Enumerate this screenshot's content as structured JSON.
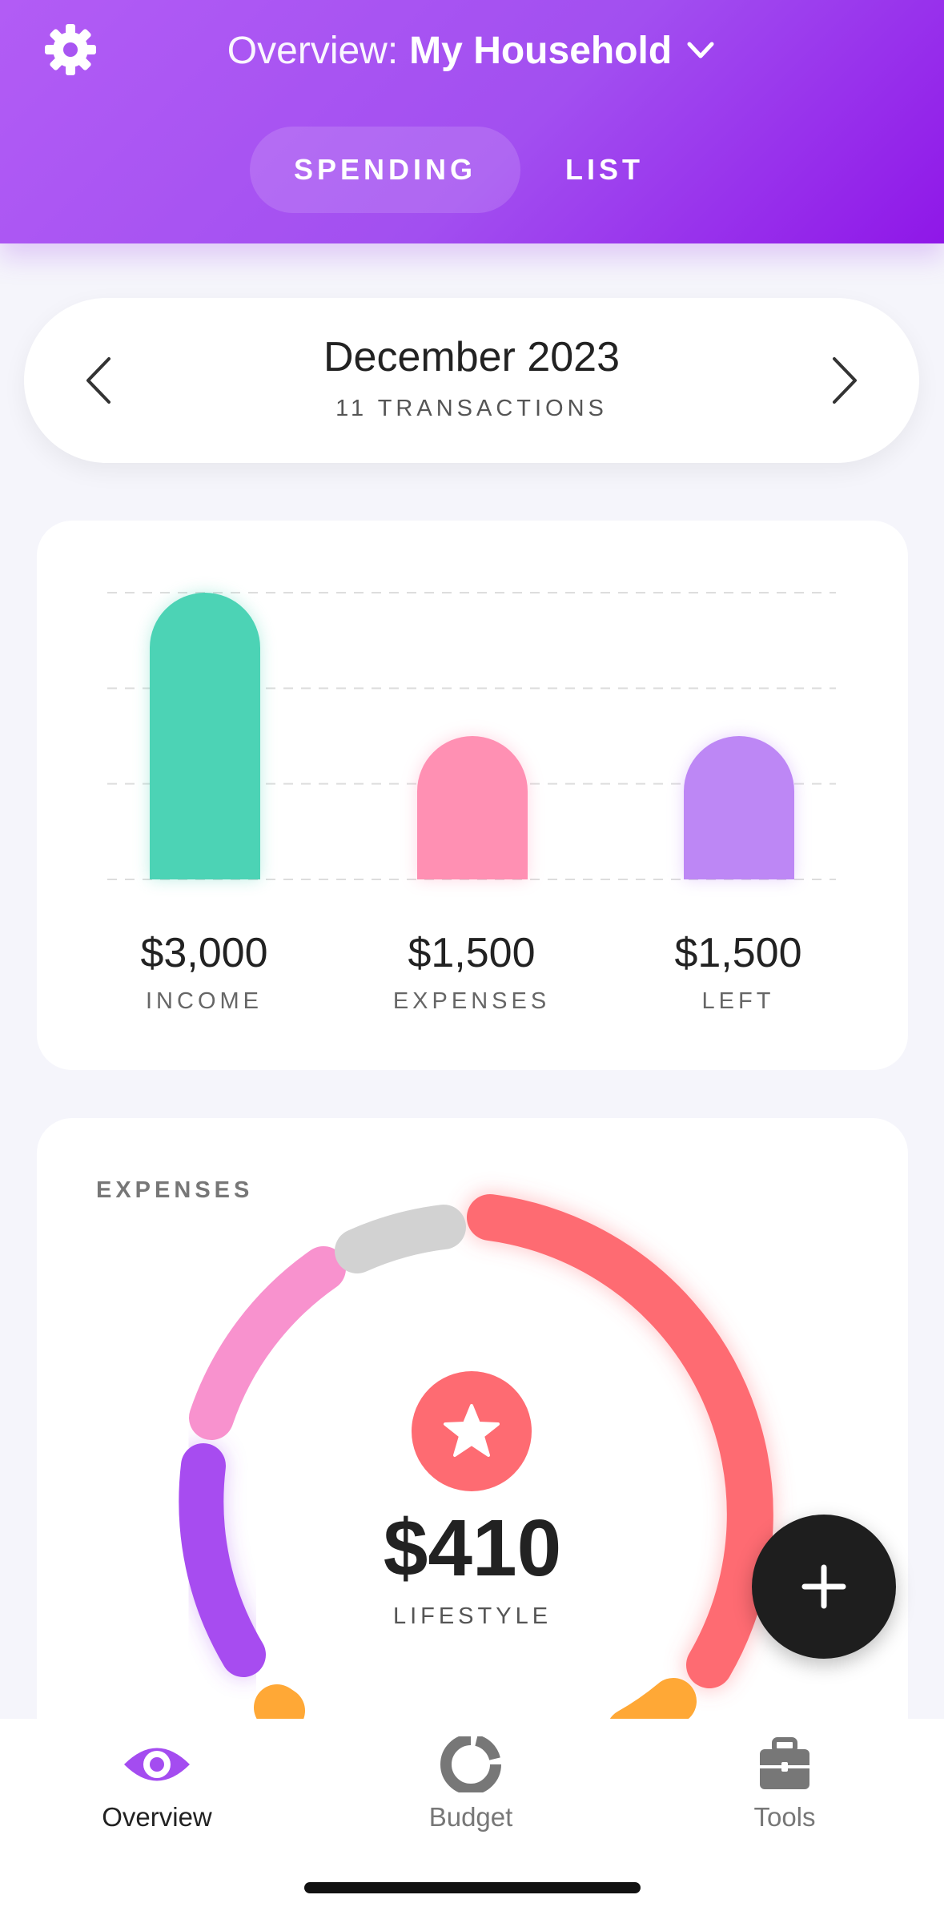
{
  "header": {
    "title_prefix": "Overview:",
    "title_name": "My Household",
    "icons": {
      "settings": "gear-icon",
      "dropdown": "chevron-down-icon"
    },
    "tabs": [
      {
        "label": "SPENDING",
        "active": true
      },
      {
        "label": "LIST",
        "active": false
      }
    ]
  },
  "period": {
    "month": "December 2023",
    "transactions": "11 TRANSACTIONS"
  },
  "summary": {
    "items": [
      {
        "value": "$3,000",
        "label": "INCOME"
      },
      {
        "value": "$1,500",
        "label": "EXPENSES"
      },
      {
        "value": "$1,500",
        "label": "LEFT"
      }
    ]
  },
  "chart_data": {
    "type": "bar",
    "categories": [
      "INCOME",
      "EXPENSES",
      "LEFT"
    ],
    "values": [
      3000,
      1500,
      1500
    ],
    "ylim": [
      0,
      3000
    ],
    "grid": true,
    "colors": [
      "#4cd3b5",
      "#ff90b3",
      "#bd87f5"
    ]
  },
  "expenses": {
    "label": "EXPENSES",
    "selected_amount": "$410",
    "selected_label": "LIFESTYLE",
    "selected_icon": "star-icon",
    "selected_color": "#fe6b72"
  },
  "fab": {
    "icon": "plus-icon"
  },
  "nav": {
    "items": [
      {
        "label": "Overview",
        "icon": "eye-icon",
        "active": true,
        "color": "#a44cf0"
      },
      {
        "label": "Budget",
        "icon": "donut-chart-icon",
        "active": false,
        "color": "#777777"
      },
      {
        "label": "Tools",
        "icon": "briefcase-icon",
        "active": false,
        "color": "#777777"
      }
    ]
  }
}
